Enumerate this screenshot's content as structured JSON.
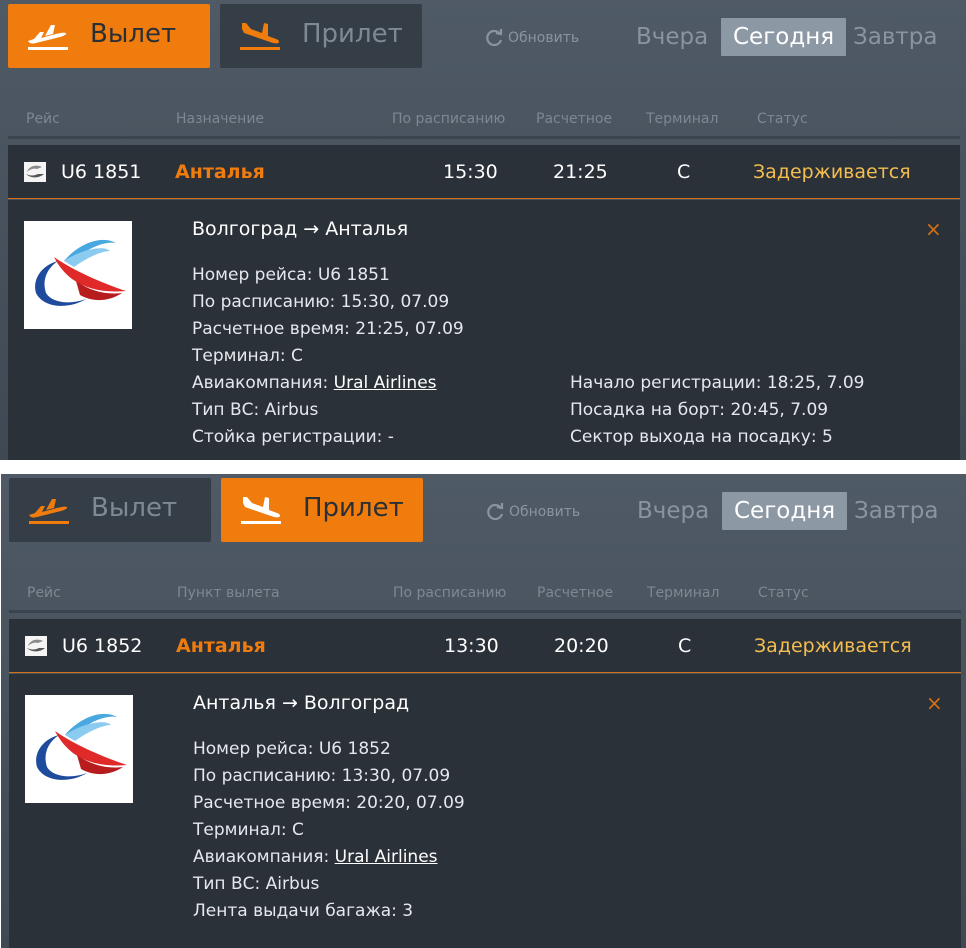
{
  "panels": [
    {
      "departure_label": "Вылет",
      "arrival_label": "Прилет",
      "active_tab": "departure",
      "refresh_label": "Обновить",
      "days": [
        "Вчера",
        "Сегодня",
        "Завтра"
      ],
      "columns": [
        "Рейс",
        "Назначение",
        "По расписанию",
        "Расчетное",
        "Терминал",
        "Статус"
      ],
      "flight": {
        "number": "U6 1851",
        "city": "Анталья",
        "scheduled": "15:30",
        "estimated": "21:25",
        "terminal": "C",
        "status": "Задерживается"
      },
      "detail": {
        "route": "Волгоград → Анталья",
        "left": [
          "Номер рейса: U6 1851",
          "По расписанию: 15:30, 07.09",
          "Расчетное время: 21:25, 07.09",
          "Терминал: C"
        ],
        "airline_prefix": "Авиакомпания: ",
        "airline": "Ural Airlines",
        "aircraft": "Тип ВС: Airbus",
        "extra": "Стойка регистрации: -",
        "right": [
          "Начало регистрации: 18:25, 7.09",
          "Посадка на борт: 20:45, 7.09",
          "Сектор выхода на посадку: 5"
        ],
        "close": "×"
      }
    },
    {
      "departure_label": "Вылет",
      "arrival_label": "Прилет",
      "active_tab": "arrival",
      "refresh_label": "Обновить",
      "days": [
        "Вчера",
        "Сегодня",
        "Завтра"
      ],
      "columns": [
        "Рейс",
        "Пункт вылета",
        "По расписанию",
        "Расчетное",
        "Терминал",
        "Статус"
      ],
      "flight": {
        "number": "U6 1852",
        "city": "Анталья",
        "scheduled": "13:30",
        "estimated": "20:20",
        "terminal": "C",
        "status": "Задерживается"
      },
      "detail": {
        "route": "Анталья → Волгоград",
        "left": [
          "Номер рейса: U6 1852",
          "По расписанию: 13:30, 07.09",
          "Расчетное время: 20:20, 07.09",
          "Терминал: C"
        ],
        "airline_prefix": "Авиакомпания: ",
        "airline": "Ural Airlines",
        "aircraft": "Тип ВС: Airbus",
        "extra": "Лента выдачи багажа: 3",
        "right": [],
        "close": "×"
      }
    }
  ],
  "colors": {
    "accent": "#f07c0d",
    "status": "#f4bd4e",
    "panel_bg": "#45505b",
    "row_bg": "#2b3139"
  },
  "icons": {
    "departure": "plane-takeoff-icon",
    "arrival": "plane-landing-icon",
    "refresh": "refresh-icon",
    "close": "close-icon",
    "airline_logo": "ural-airlines-logo"
  }
}
